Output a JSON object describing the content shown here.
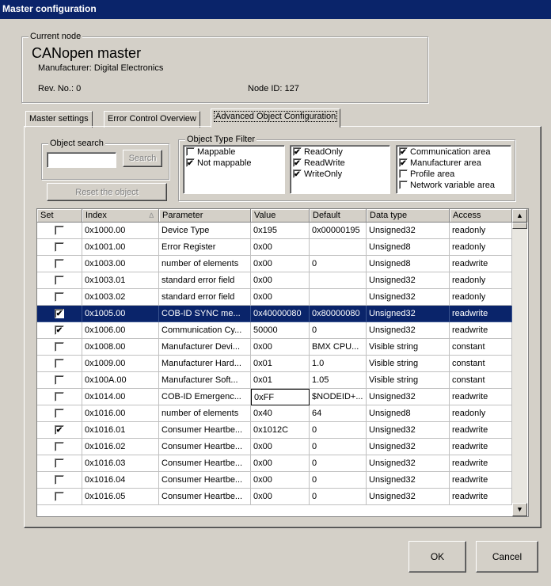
{
  "window": {
    "title": "Master configuration"
  },
  "current_node": {
    "legend": "Current node",
    "name": "CANopen master",
    "manufacturer": "Manufacturer: Digital Electronics",
    "rev": "Rev. No.: 0",
    "node_id": "Node ID: 127"
  },
  "tabs": [
    {
      "label": "Master settings"
    },
    {
      "label": "Error Control Overview"
    },
    {
      "label": "Advanced Object Configuration"
    }
  ],
  "object_search": {
    "legend": "Object search",
    "input_value": "",
    "search_label": "Search",
    "reset_label": "Reset the object"
  },
  "type_filter": {
    "legend": "Object Type Filter",
    "group1": [
      {
        "label": "Mappable",
        "checked": false
      },
      {
        "label": "Not mappable",
        "checked": true
      }
    ],
    "group2": [
      {
        "label": "ReadOnly",
        "checked": true
      },
      {
        "label": "ReadWrite",
        "checked": true
      },
      {
        "label": "WriteOnly",
        "checked": true
      }
    ],
    "group3": [
      {
        "label": "Communication area",
        "checked": true
      },
      {
        "label": "Manufacturer area",
        "checked": true
      },
      {
        "label": "Profile area",
        "checked": false
      },
      {
        "label": "Network variable area",
        "checked": false
      }
    ]
  },
  "table": {
    "headers": [
      "Set",
      "Index",
      "Parameter",
      "Value",
      "Default",
      "Data type",
      "Access"
    ],
    "sort_indicator": "∆",
    "rows": [
      {
        "set": false,
        "index": "0x1000.00",
        "parameter": "Device Type",
        "value": "0x195",
        "default": "0x00000195",
        "type": "Unsigned32",
        "access": "readonly"
      },
      {
        "set": false,
        "index": "0x1001.00",
        "parameter": "Error Register",
        "value": "0x00",
        "default": "",
        "type": "Unsigned8",
        "access": "readonly"
      },
      {
        "set": false,
        "index": "0x1003.00",
        "parameter": "number of elements",
        "value": "0x00",
        "default": "0",
        "type": "Unsigned8",
        "access": "readwrite"
      },
      {
        "set": false,
        "index": "0x1003.01",
        "parameter": "standard error field",
        "value": "0x00",
        "default": "",
        "type": "Unsigned32",
        "access": "readonly"
      },
      {
        "set": false,
        "index": "0x1003.02",
        "parameter": "standard error field",
        "value": "0x00",
        "default": "",
        "type": "Unsigned32",
        "access": "readonly"
      },
      {
        "set": true,
        "index": "0x1005.00",
        "parameter": "COB-ID SYNC me...",
        "value": "0x40000080",
        "default": "0x80000080",
        "type": "Unsigned32",
        "access": "readwrite",
        "selected": true
      },
      {
        "set": true,
        "index": "0x1006.00",
        "parameter": "Communication Cy...",
        "value": "50000",
        "default": "0",
        "type": "Unsigned32",
        "access": "readwrite"
      },
      {
        "set": false,
        "index": "0x1008.00",
        "parameter": "Manufacturer Devi...",
        "value": "0x00",
        "default": "BMX CPU...",
        "type": "Visible string",
        "access": "constant"
      },
      {
        "set": false,
        "index": "0x1009.00",
        "parameter": "Manufacturer Hard...",
        "value": "0x01",
        "default": "1.0",
        "type": "Visible string",
        "access": "constant"
      },
      {
        "set": false,
        "index": "0x100A.00",
        "parameter": "Manufacturer Soft...",
        "value": "0x01",
        "default": "1.05",
        "type": "Visible string",
        "access": "constant"
      },
      {
        "set": false,
        "index": "0x1014.00",
        "parameter": "COB-ID Emergenc...",
        "value": "0xFF",
        "default": "$NODEID+...",
        "type": "Unsigned32",
        "access": "readwrite",
        "editing": true
      },
      {
        "set": false,
        "index": "0x1016.00",
        "parameter": "number of elements",
        "value": "0x40",
        "default": "64",
        "type": "Unsigned8",
        "access": "readonly"
      },
      {
        "set": true,
        "index": "0x1016.01",
        "parameter": "Consumer Heartbe...",
        "value": "0x1012C",
        "default": "0",
        "type": "Unsigned32",
        "access": "readwrite"
      },
      {
        "set": false,
        "index": "0x1016.02",
        "parameter": "Consumer Heartbe...",
        "value": "0x00",
        "default": "0",
        "type": "Unsigned32",
        "access": "readwrite"
      },
      {
        "set": false,
        "index": "0x1016.03",
        "parameter": "Consumer Heartbe...",
        "value": "0x00",
        "default": "0",
        "type": "Unsigned32",
        "access": "readwrite"
      },
      {
        "set": false,
        "index": "0x1016.04",
        "parameter": "Consumer Heartbe...",
        "value": "0x00",
        "default": "0",
        "type": "Unsigned32",
        "access": "readwrite"
      },
      {
        "set": false,
        "index": "0x1016.05",
        "parameter": "Consumer Heartbe...",
        "value": "0x00",
        "default": "0",
        "type": "Unsigned32",
        "access": "readwrite"
      }
    ]
  },
  "buttons": {
    "ok": "OK",
    "cancel": "Cancel"
  },
  "colors": {
    "titlebar": "#0a246a",
    "dialog_bg": "#d4d0c8",
    "selection": "#0a246a"
  },
  "icons": {
    "scroll_up": "▲",
    "scroll_down": "▼",
    "check": "✔"
  }
}
